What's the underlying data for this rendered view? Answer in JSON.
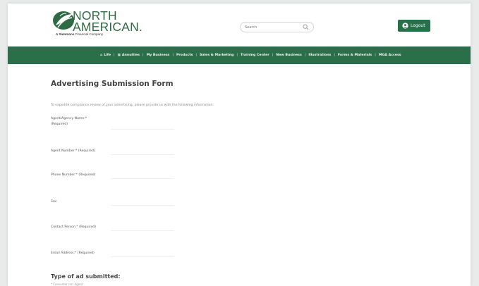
{
  "brand": {
    "name_line1": "NORTH",
    "name_line2": "AMERICAN.",
    "tagline_brand": "A Sammons",
    "tagline_rest": "Financial Company"
  },
  "header": {
    "search_placeholder": "Search",
    "logout_label": "Logout"
  },
  "nav": {
    "items": [
      {
        "label": "Life",
        "icon": "home-icon"
      },
      {
        "label": "Annuities",
        "icon": "grid-icon"
      },
      {
        "label": "My Business"
      },
      {
        "label": "Products"
      },
      {
        "label": "Sales & Marketing"
      },
      {
        "label": "Training Center"
      },
      {
        "label": "New Business"
      },
      {
        "label": "Illustrations"
      },
      {
        "label": "Forms & Materials"
      },
      {
        "label": "MGA Access"
      }
    ]
  },
  "form": {
    "title": "Advertising Submission Form",
    "intro": "To expedite compliance review of your advertising, please provide us with the following information:",
    "fields": [
      {
        "label_line1": "Agent/Agency Name:*",
        "label_line2": "(Required)"
      },
      {
        "label_line1": "Agent Number:* (Required)",
        "label_line2": ""
      },
      {
        "label_line1": "Phone Number:* (Required)",
        "label_line2": ""
      },
      {
        "label_line1": "Fax:",
        "label_line2": ""
      },
      {
        "label_line1": "Contact Person:* (Required)",
        "label_line2": ""
      },
      {
        "label_line1": "Email Address:* (Required)",
        "label_line2": ""
      }
    ],
    "section_title": "Type of ad submitted:",
    "section_note": "* Consumer (or) Agent"
  },
  "colors": {
    "brand_green": "#2a6f49",
    "button_green": "#27704a",
    "logo_green": "#2e6b45"
  }
}
